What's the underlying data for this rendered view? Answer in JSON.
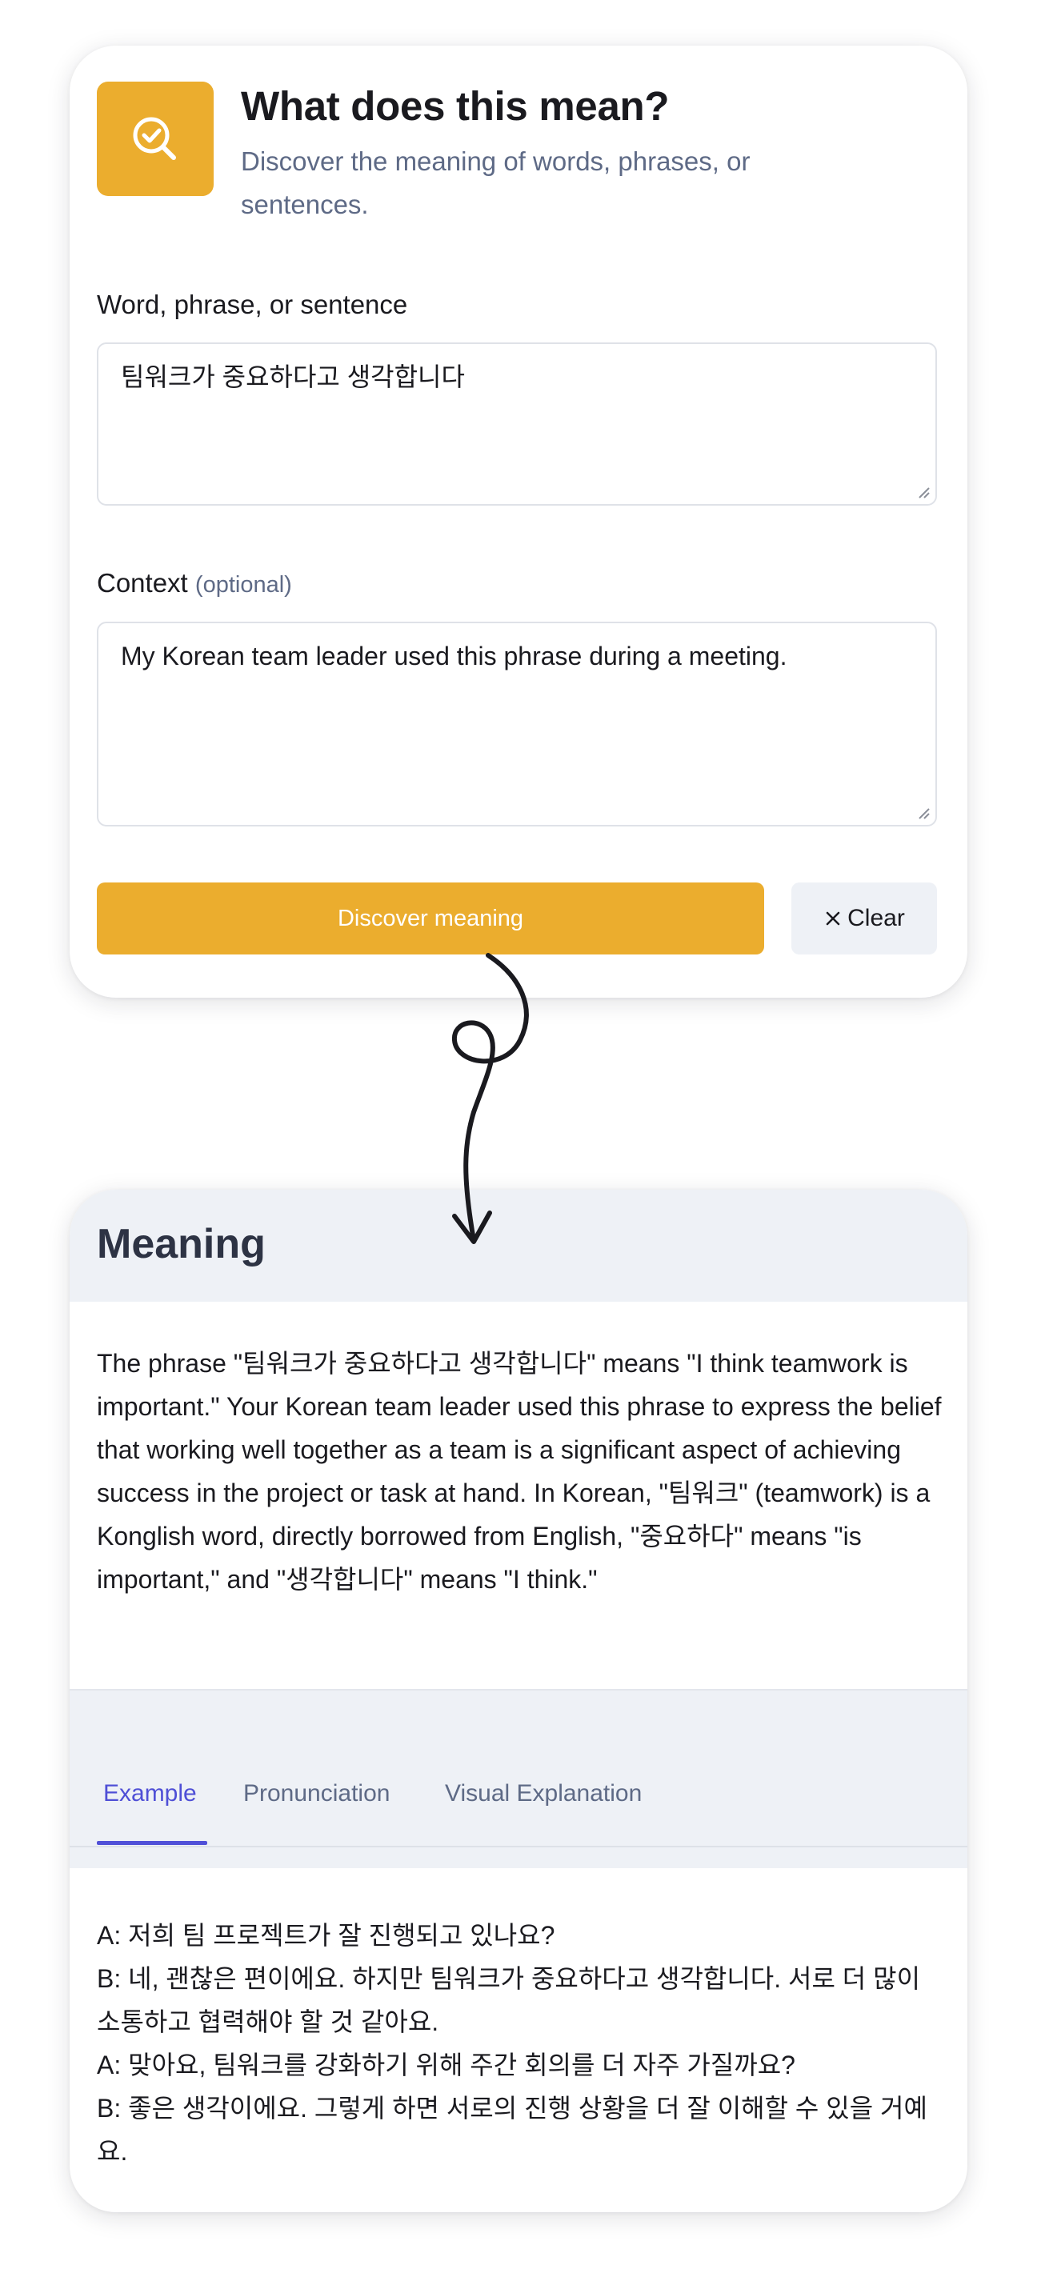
{
  "form": {
    "title": "What does this mean?",
    "subtitle": "Discover the meaning of words, phrases, or sentences.",
    "word_label": "Word, phrase, or sentence",
    "word_value": "팀워크가 중요하다고 생각합니다",
    "context_label": "Context",
    "context_hint": "(optional)",
    "context_value": "My Korean team leader used this phrase during a meeting.",
    "discover_label": "Discover meaning",
    "clear_label": "Clear",
    "app_icon": "magnifier-check-icon"
  },
  "result": {
    "heading": "Meaning",
    "explanation": "The phrase \"팀워크가 중요하다고 생각합니다\" means \"I think teamwork is important.\" Your Korean team leader used this phrase to express the belief that working well together as a team is a significant aspect of achieving success in the project or task at hand. In Korean, \"팀워크\" (teamwork) is a Konglish word, directly borrowed from English, \"중요하다\" means \"is important,\" and \"생각합니다\" means \"I think.\"",
    "tabs": [
      {
        "label": "Example",
        "active": true
      },
      {
        "label": "Pronunciation",
        "active": false
      },
      {
        "label": "Visual Explanation",
        "active": false
      }
    ],
    "example_lines": [
      "A: 저희 팀 프로젝트가 잘 진행되고 있나요?",
      "B: 네, 괜찮은 편이에요. 하지만 팀워크가 중요하다고 생각합니다. 서로 더 많이 소통하고 협력해야 할 것 같아요.",
      "A: 맞아요, 팀워크를 강화하기 위해 주간 회의를 더 자주 가질까요?",
      "B: 좋은 생각이에요. 그렇게 하면 서로의 진행 상황을 더 잘 이해할 수 있을 거예요."
    ]
  },
  "colors": {
    "accent": "#ebad2e",
    "tab_active": "#5050d8",
    "muted_text": "#5e6a86",
    "panel_bg": "#eef1f6"
  }
}
